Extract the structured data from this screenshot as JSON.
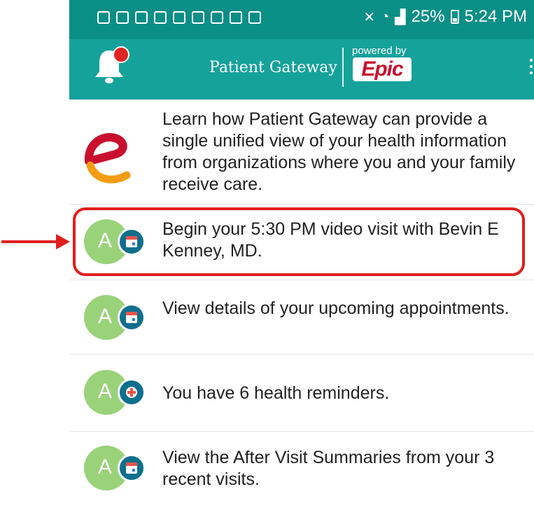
{
  "status_bar": {
    "battery": "25%",
    "time": "5:24 PM",
    "notification_icons": [
      "gmail-icon",
      "gmail-icon",
      "gmail-icon",
      "question-icon",
      "image-icon",
      "bag-icon",
      "keyhole-icon",
      "shield-icon",
      "shield-icon"
    ],
    "signal_icons": [
      "mute-icon",
      "wifi-icon",
      "signal-icon"
    ]
  },
  "app_bar": {
    "title": "Patient Gateway",
    "powered_by": "powered by",
    "brand": "Epic",
    "notification_has_badge": true
  },
  "feed": [
    {
      "icon": "epic-e-logo",
      "text": "Learn how Patient Gateway can provide a single unified view of your health information from organizations where you and your family receive care."
    },
    {
      "icon": "calendar-icon",
      "avatar_letter": "A",
      "text": "Begin your 5:30 PM video visit with Bevin E Kenney, MD.",
      "highlighted": true
    },
    {
      "icon": "calendar-icon",
      "avatar_letter": "A",
      "text": "View details of your upcoming appointments."
    },
    {
      "icon": "medical-cross-icon",
      "avatar_letter": "A",
      "text": "You have 6 health reminders."
    },
    {
      "icon": "calendar-icon",
      "avatar_letter": "A",
      "text": "View the After Visit Summaries from your 3 recent visits."
    }
  ],
  "colors": {
    "status_bar": "#0a8f86",
    "app_bar": "#15a29a",
    "avatar": "#9ad27a",
    "badge": "#0f6f8c",
    "highlight": "#e01f1f",
    "epic_red": "#c8102e"
  }
}
